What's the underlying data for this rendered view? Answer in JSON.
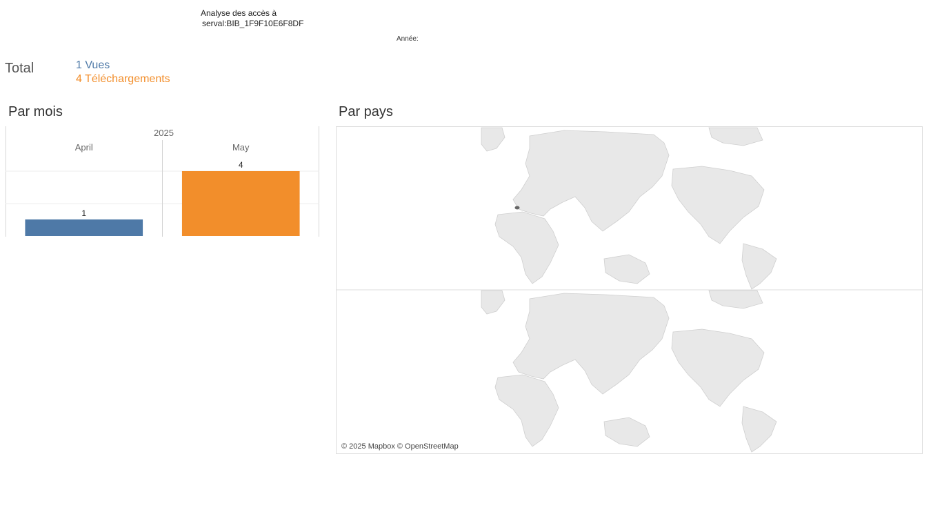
{
  "header": {
    "title_line1": "Analyse des accès à",
    "title_line2": "serval:BIB_1F9F10E6F8DF",
    "year_filter_label": "Année:"
  },
  "totals": {
    "label": "Total",
    "views": "1 Vues",
    "downloads": "4 Téléchargements"
  },
  "sections": {
    "monthly": "Par mois",
    "country": "Par pays"
  },
  "colors": {
    "views": "#4e79a7",
    "downloads": "#f28e2b",
    "map_land": "#e8e8e8",
    "map_border": "#cfcfcf",
    "highlight_country": "#666666"
  },
  "chart_data": {
    "type": "bar",
    "year": "2025",
    "categories": [
      "April",
      "May"
    ],
    "values": [
      1,
      4
    ],
    "series_keys": [
      "views",
      "downloads"
    ],
    "data_labels": [
      "1",
      "4"
    ],
    "ylim": [
      0,
      4
    ],
    "grid": true
  },
  "map": {
    "panels": [
      "views",
      "downloads"
    ],
    "highlighted_country": "Switzerland",
    "highlight_panel": "views",
    "icon": "world-map-icon",
    "attribution": "© 2025 Mapbox © OpenStreetMap"
  }
}
